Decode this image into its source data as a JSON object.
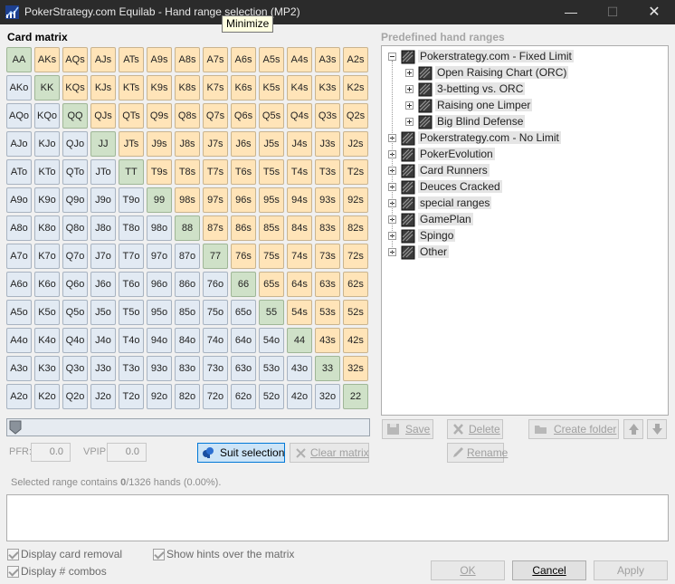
{
  "window": {
    "title": "PokerStrategy.com Equilab - Hand range selection (MP2)",
    "tooltip": "Minimize",
    "minimize_glyph": "—",
    "maximize_glyph": "☐",
    "close_glyph": "✕"
  },
  "matrix": {
    "label": "Card matrix",
    "ranks": [
      "A",
      "K",
      "Q",
      "J",
      "T",
      "9",
      "8",
      "7",
      "6",
      "5",
      "4",
      "3",
      "2"
    ],
    "colors": {
      "suited": "#ffe4b8",
      "offsuit": "#e2eaf3",
      "pair": "#cfe1c8"
    }
  },
  "controls": {
    "pfr_label": "PFR:",
    "pfr_value": "0.0",
    "vpip_label": "VPIP:",
    "vpip_value": "0.0",
    "suit_selection": "Suit selection",
    "clear_matrix": "Clear matrix",
    "slider_value": 0
  },
  "status": {
    "prefix": "Selected range contains ",
    "selected_count": "0",
    "suffix": "/1326 hands (0.00%)."
  },
  "options": {
    "display_card_removal": "Display card removal",
    "display_combos": "Display # combos",
    "show_hints": "Show hints over the matrix"
  },
  "predefined": {
    "label": "Predefined hand ranges",
    "tree": [
      {
        "label": "Pokerstrategy.com - Fixed Limit",
        "expanded": true,
        "children": [
          {
            "label": "Open Raising Chart (ORC)"
          },
          {
            "label": "3-betting vs. ORC"
          },
          {
            "label": "Raising one Limper"
          },
          {
            "label": "Big Blind Defense"
          }
        ]
      },
      {
        "label": "Pokerstrategy.com - No Limit"
      },
      {
        "label": "PokerEvolution"
      },
      {
        "label": "Card Runners"
      },
      {
        "label": "Deuces Cracked"
      },
      {
        "label": "special ranges"
      },
      {
        "label": "GamePlan"
      },
      {
        "label": "Spingo"
      },
      {
        "label": "Other"
      }
    ],
    "save": "Save",
    "delete": "Delete",
    "create_folder": "Create folder",
    "rename": "Rename"
  },
  "dialog": {
    "ok": "OK",
    "cancel": "Cancel",
    "apply": "Apply"
  }
}
